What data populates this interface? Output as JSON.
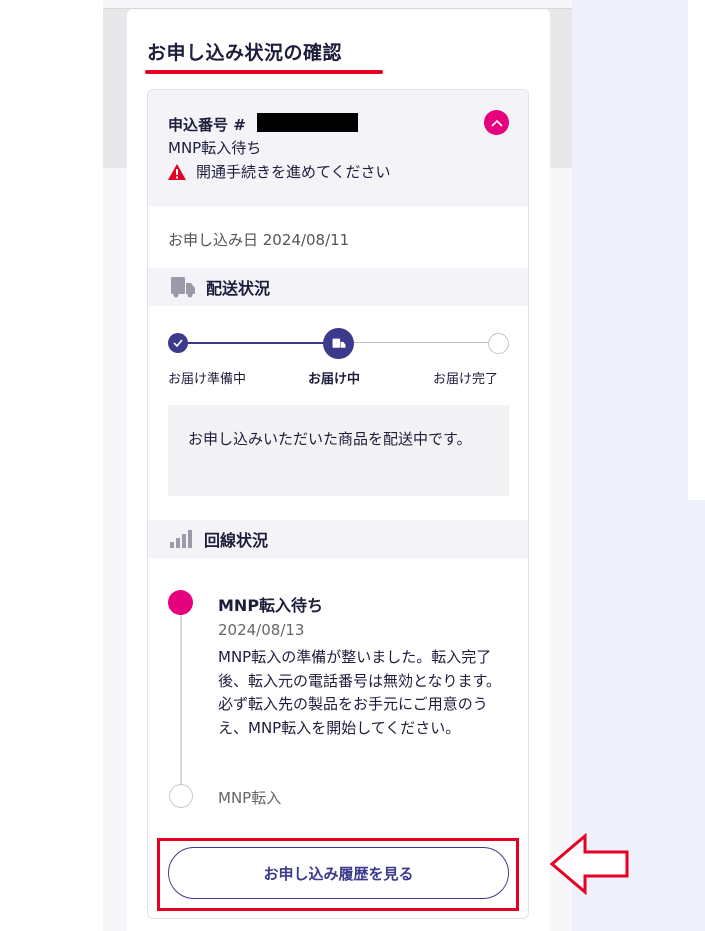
{
  "page": {
    "title": "お申し込み状況の確認"
  },
  "application": {
    "number_label": "申込番号 #",
    "status": "MNP転入待ち",
    "warning": "開通手続きを進めてください",
    "date_label": "お申し込み日 2024/08/11"
  },
  "delivery": {
    "heading": "配送状況",
    "steps": [
      {
        "label": "お届け準備中",
        "state": "done"
      },
      {
        "label": "お届け中",
        "state": "current"
      },
      {
        "label": "お届け完了",
        "state": "todo"
      }
    ],
    "message": "お申し込みいただいた商品を配送中です。"
  },
  "line": {
    "heading": "回線状況",
    "timeline": [
      {
        "title": "MNP転入待ち",
        "date": "2024/08/13",
        "desc": "MNP転入の準備が整いました。転入完了後、転入元の電話番号は無効となります。必ず転入先の製品をお手元にご用意のうえ、MNP転入を開始してください。"
      },
      {
        "title": "MNP転入"
      }
    ]
  },
  "history_button": "お申し込み履歴を見る",
  "colors": {
    "accent": "#3c3a8c",
    "pink": "#e6007e",
    "red": "#e60023"
  },
  "icons": [
    "chevron-up-icon",
    "warning-icon",
    "truck-icon",
    "signal-icon",
    "check-icon",
    "arrow-left-icon"
  ]
}
